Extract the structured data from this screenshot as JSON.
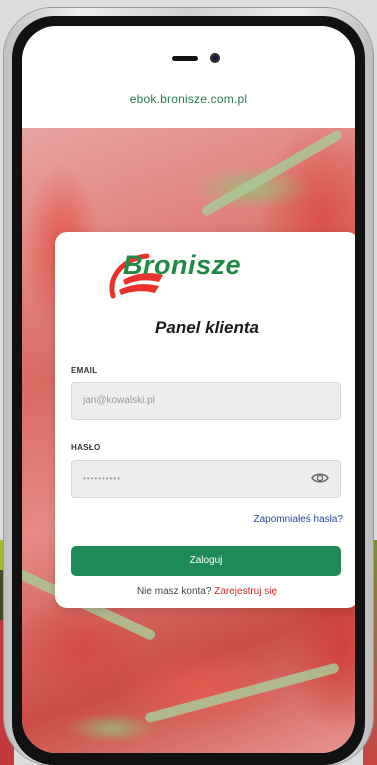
{
  "browser": {
    "url": "ebok.bronisze.com.pl"
  },
  "brand": {
    "name": "Bronisze",
    "green": "#1e8a45",
    "red": "#e8322a",
    "logo_icon": "bronisze-swoosh-logo"
  },
  "login": {
    "title": "Panel klienta",
    "email_label": "EMAIL",
    "email_placeholder": "jan@kowalski.pl",
    "password_label": "HASŁO",
    "password_value": "••••••••••",
    "show_password_icon": "eye-icon",
    "forgot_link": "Zapomniałeś hasła?",
    "submit_label": "Zaloguj",
    "no_account_text": "Nie masz konta?",
    "register_link": "Zarejestruj się"
  },
  "colors": {
    "button_bg": "#1e8a57",
    "link_blue": "#2a4a9c",
    "link_red": "#d52a2a"
  }
}
